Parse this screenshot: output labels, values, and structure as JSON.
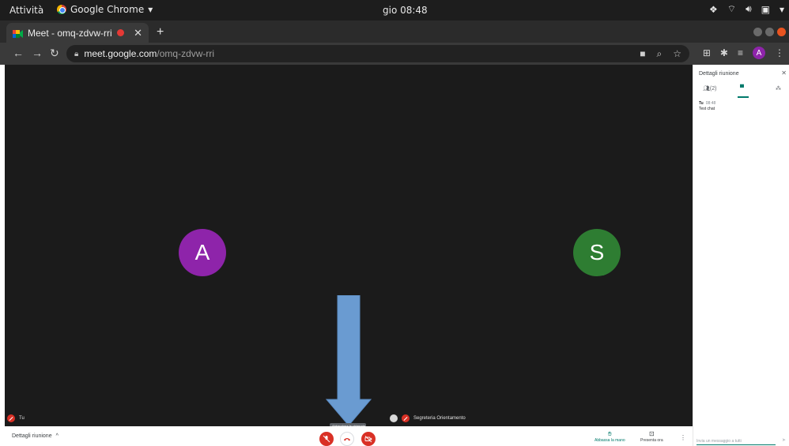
{
  "system": {
    "activities": "Attività",
    "app_name": "Google Chrome",
    "clock": "gio 08:48"
  },
  "browser": {
    "tab_title": "Meet - omq-zdvw-rri",
    "url_host": "meet.google.com",
    "url_path": "/omq-zdvw-rri",
    "profile_initial": "A"
  },
  "meeting": {
    "participants": [
      {
        "initial": "A",
        "color": "#8e24aa",
        "label": "Tu"
      },
      {
        "initial": "S",
        "color": "#2e7d32",
        "label": "Segreteria Orientamento"
      }
    ],
    "hangup_tooltip": "Abbandona la chiamata",
    "details_label": "Dettagli riunione",
    "raise_hand_label": "Abbassa la mano",
    "present_label": "Presenta ora"
  },
  "panel": {
    "title": "Dettagli riunione",
    "people_count": "(2)",
    "message": {
      "sender": "Tu",
      "time": "08:48",
      "text": "Test chat"
    },
    "input_placeholder": "Invia un messaggio a tutti"
  }
}
